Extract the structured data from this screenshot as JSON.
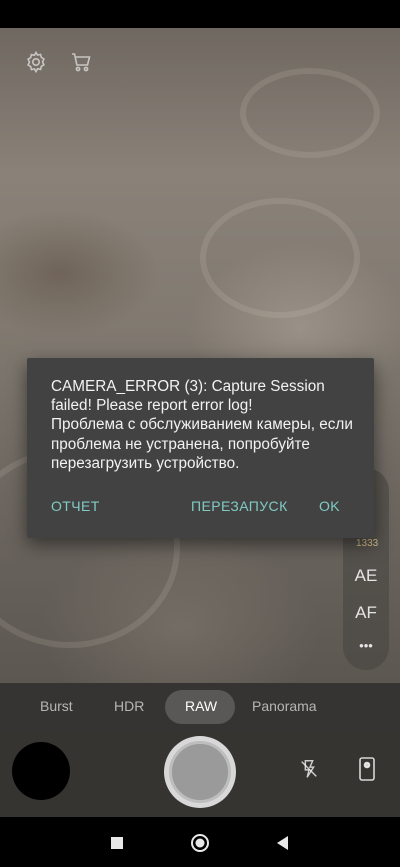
{
  "dialog": {
    "message": "CAMERA_ERROR (3): Capture Session failed! Please report error log!\nПроблема с обслуживанием камеры, если проблема не устранена, попробуйте перезагрузить устройство.",
    "report_label": "ОТЧЕТ",
    "restart_label": "ПЕРЕЗАПУСК",
    "ok_label": "OK"
  },
  "modes": {
    "items": [
      "Burst",
      "HDR",
      "RAW",
      "Panorama"
    ],
    "selected": "RAW"
  },
  "side_panel": {
    "value": "1333",
    "ae_label": "AE",
    "af_label": "AF",
    "more_label": "•••"
  },
  "icons": {
    "settings": "gear-icon",
    "store": "cart-icon",
    "flash": "flash-off-icon",
    "switch_camera": "camera-switch-icon",
    "nav_recents": "square-icon",
    "nav_home": "circle-icon",
    "nav_back": "triangle-back-icon"
  },
  "colors": {
    "dialog_bg": "#424242",
    "dialog_button": "#80cbc4",
    "dialog_text": "#f2f2f2"
  }
}
